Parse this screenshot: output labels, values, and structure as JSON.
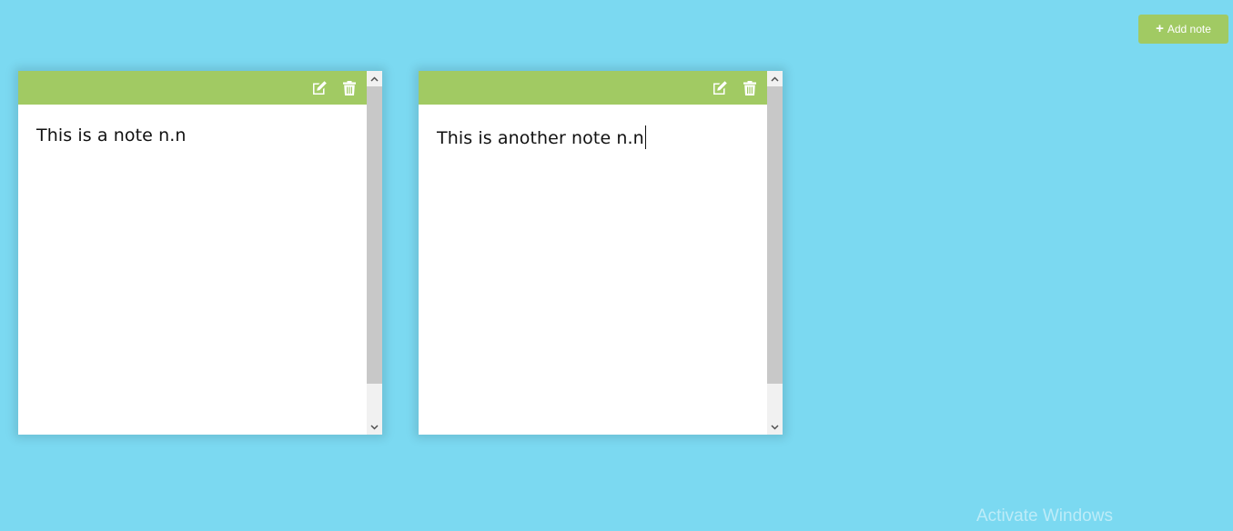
{
  "toolbar": {
    "add_label": "Add note",
    "add_icon": "plus-icon"
  },
  "notes": [
    {
      "text": "This is a note n.n",
      "actions": [
        "edit-icon",
        "trash-icon"
      ],
      "focused": false
    },
    {
      "text": "This is another note n.n",
      "actions": [
        "edit-icon",
        "trash-icon"
      ],
      "focused": true
    }
  ],
  "watermark": {
    "text": "Activate Windows"
  },
  "colors": {
    "background": "#7bd9f1",
    "accent": "#a1ca63",
    "note": "#ffffff",
    "scroll_thumb": "#c8c8c8"
  }
}
